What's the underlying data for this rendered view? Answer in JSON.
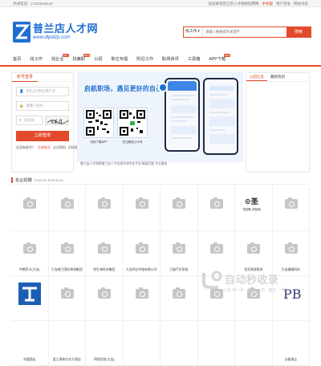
{
  "topbar": {
    "hotline": "热线电话：17153645110",
    "welcome": "欢迎来到普兰店人才网络招聘网",
    "links": [
      "手机版",
      "用户登录",
      "网站导航"
    ]
  },
  "logo": {
    "title": "普兰店人才网",
    "url": "www.dlpldzp.com",
    "mark_letter": "Z"
  },
  "search": {
    "type": "找工作",
    "placeholder": "请输入要搜索的关键字",
    "button": "搜索"
  },
  "nav": {
    "items": [
      {
        "label": "首页",
        "badge": ""
      },
      {
        "label": "找工作",
        "badge": ""
      },
      {
        "label": "找企业",
        "badge": "HOT"
      },
      {
        "label": "找兼职",
        "badge": "NEW"
      },
      {
        "label": "公招",
        "badge": ""
      },
      {
        "label": "职位专题",
        "badge": ""
      },
      {
        "label": "附近工作",
        "badge": ""
      },
      {
        "label": "职场资讯",
        "badge": ""
      },
      {
        "label": "工具箱",
        "badge": ""
      },
      {
        "label": "APP下载",
        "badge": "NEW"
      }
    ]
  },
  "login": {
    "tab": "账号登录",
    "username_placeholder": "手机号/手机/用户名",
    "password_placeholder": "请输入密码",
    "captcha_placeholder": "验证码",
    "submit": "立即登录",
    "links": [
      "还没有账号？",
      "注册账号",
      "忘记密码",
      "扫码登录"
    ]
  },
  "banner": {
    "headline": "启航职场，遇见更好的自己",
    "qr1_caption": "扫码下载APP",
    "qr2_caption": "关注微信公众号",
    "footnote": "普兰店人才网是普兰店人才信息交流专业平台 精准匹配 专业服务"
  },
  "notice": {
    "tabs": [
      "公招信息",
      "最新资讯"
    ]
  },
  "famous": {
    "title": "名企招聘",
    "subtitle": "Famous Enterprise"
  },
  "companies": [
    {
      "name": "",
      "logo": "camera-placeholder"
    },
    {
      "name": "",
      "logo": "camera-placeholder"
    },
    {
      "name": "",
      "logo": "camera-placeholder"
    },
    {
      "name": "",
      "logo": "camera-placeholder"
    },
    {
      "name": "",
      "logo": "camera-placeholder"
    },
    {
      "name": "",
      "logo": "camera-placeholder"
    },
    {
      "name": "",
      "logo": "SUN ASIA"
    },
    {
      "name": "",
      "logo": "camera-placeholder"
    },
    {
      "name": "中粮家丰(大连)",
      "logo": "camera-placeholder"
    },
    {
      "name": "大连顺兰国际物流集团",
      "logo": "camera-placeholder"
    },
    {
      "name": "铭生海科技集团",
      "logo": "camera-placeholder"
    },
    {
      "name": "大连四达华链有限公司",
      "logo": "camera-placeholder"
    },
    {
      "name": "万盛汽车贸易",
      "logo": "camera-placeholder"
    },
    {
      "name": "",
      "logo": "camera-placeholder"
    },
    {
      "name": "圣亚旅游股份",
      "logo": "camera-placeholder"
    },
    {
      "name": "大连福融科技",
      "logo": "camera-placeholder"
    },
    {
      "name": "",
      "logo": "blue-emblem"
    },
    {
      "name": "",
      "logo": "camera-placeholder"
    },
    {
      "name": "",
      "logo": "camera-placeholder"
    },
    {
      "name": "",
      "logo": "camera-placeholder"
    },
    {
      "name": "",
      "logo": "camera-placeholder"
    },
    {
      "name": "",
      "logo": "camera-placeholder"
    },
    {
      "name": "",
      "logo": "camera-placeholder"
    },
    {
      "name": "",
      "logo": "PB"
    },
    {
      "name": "东圆酒店",
      "logo": ""
    },
    {
      "name": "爱立清和伦东方酒店",
      "logo": ""
    },
    {
      "name": "四弦民航(大连)",
      "logo": ""
    },
    {
      "name": "",
      "logo": ""
    },
    {
      "name": "",
      "logo": ""
    },
    {
      "name": "",
      "logo": ""
    },
    {
      "name": "",
      "logo": ""
    },
    {
      "name": "法鲁酒店",
      "logo": ""
    }
  ],
  "watermark": {
    "title": "自动秒收录",
    "sub": "上线 快一秒 · 来访 一次 · 曝光 一秒"
  },
  "colors": {
    "accent": "#e24a2b",
    "brand": "#1f6fd1"
  }
}
